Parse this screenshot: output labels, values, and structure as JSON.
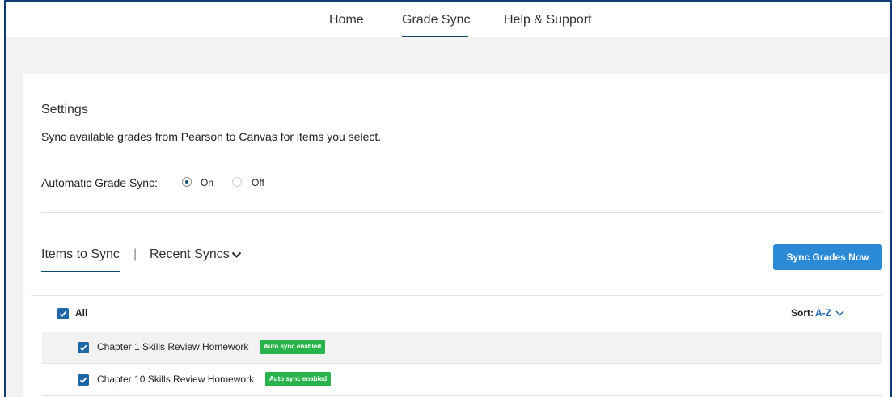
{
  "nav": {
    "home": "Home",
    "grade_sync": "Grade Sync",
    "help": "Help & Support"
  },
  "settings": {
    "title": "Settings",
    "description": "Sync available grades from Pearson to Canvas for items you select.",
    "auto_sync_label": "Automatic Grade Sync:",
    "option_on": "On",
    "option_off": "Off",
    "selected": "On"
  },
  "tabs": {
    "items_to_sync": "Items to Sync",
    "separator": "|",
    "recent_syncs": "Recent Syncs",
    "active": "Items to Sync"
  },
  "sync_button": "Sync Grades Now",
  "list": {
    "all_label": "All",
    "all_checked": true,
    "sort_label": "Sort:",
    "sort_value": "A-Z",
    "items": [
      {
        "label": "Chapter 1 Skills Review Homework",
        "badge": "Auto sync enabled",
        "checked": true
      },
      {
        "label": "Chapter 10 Skills Review Homework",
        "badge": "Auto sync enabled",
        "checked": true
      }
    ]
  },
  "colors": {
    "accent": "#2b8ad6",
    "checkbox": "#1f66a6",
    "badge": "#2ab34c",
    "frame": "#123a73"
  }
}
